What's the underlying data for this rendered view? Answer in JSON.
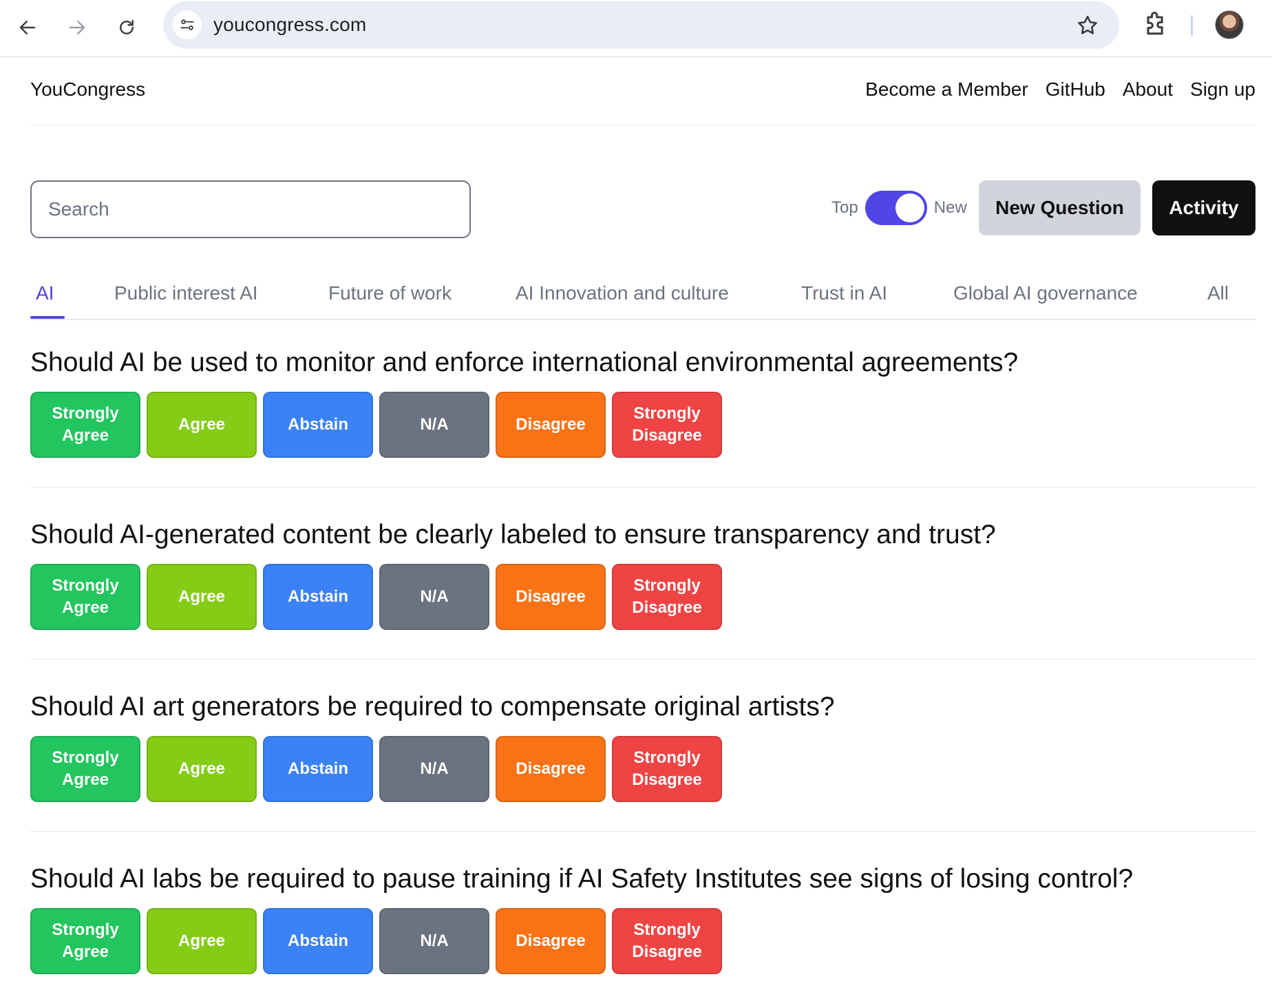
{
  "browser": {
    "url": "youcongress.com",
    "icons": [
      "back-icon",
      "forward-icon",
      "reload-icon",
      "site-info-icon",
      "bookmark-star-icon",
      "extensions-icon",
      "profile-avatar"
    ]
  },
  "header": {
    "brand": "YouCongress",
    "nav": [
      "Become a Member",
      "GitHub",
      "About",
      "Sign up"
    ]
  },
  "toolbar": {
    "search_placeholder": "Search",
    "toggle_left": "Top",
    "toggle_right": "New",
    "toggle_state": "New",
    "new_question": "New Question",
    "activity": "Activity"
  },
  "tabs": {
    "items": [
      "AI",
      "Public interest AI",
      "Future of work",
      "AI Innovation and culture",
      "Trust in AI",
      "Global AI governance",
      "All"
    ],
    "active": "AI"
  },
  "vote_options": [
    "Strongly Agree",
    "Agree",
    "Abstain",
    "N/A",
    "Disagree",
    "Strongly Disagree"
  ],
  "vote_colors": [
    "#22c55e",
    "#84cc16",
    "#3b82f6",
    "#6b7280",
    "#f97316",
    "#ef4444"
  ],
  "accent_color": "#4f46e5",
  "questions": [
    "Should AI be used to monitor and enforce international environmental agreements?",
    "Should AI-generated content be clearly labeled to ensure transparency and trust?",
    "Should AI art generators be required to compensate original artists?",
    "Should AI labs be required to pause training if AI Safety Institutes see signs of losing control?"
  ]
}
